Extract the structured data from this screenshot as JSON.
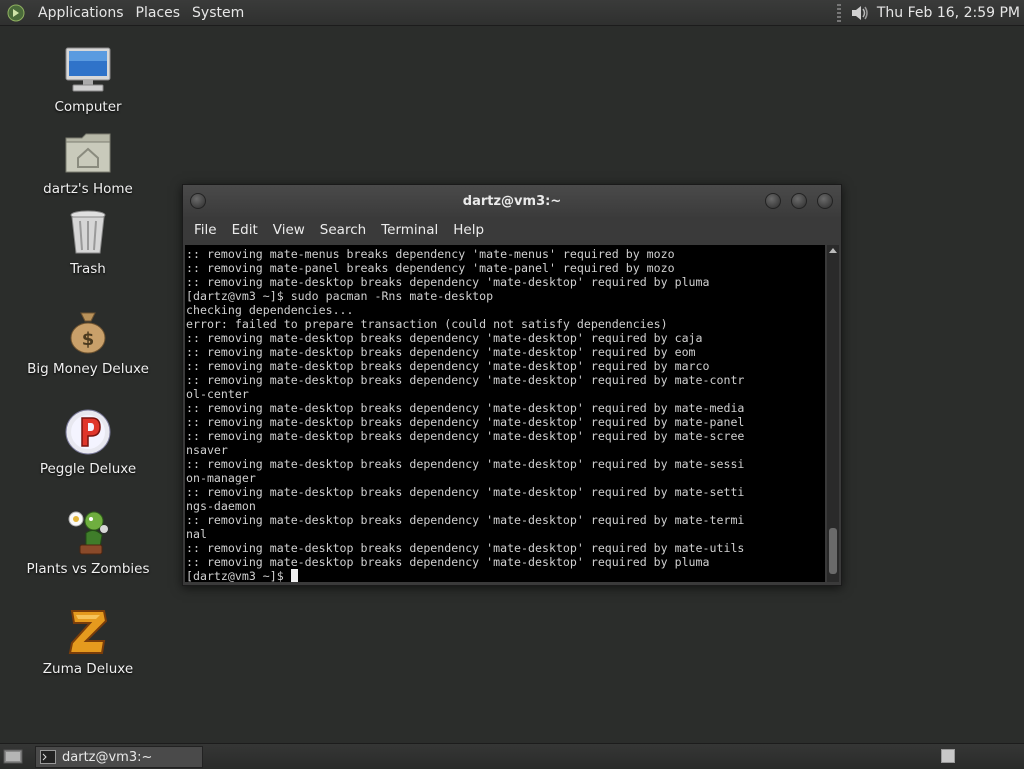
{
  "top_panel": {
    "menus": [
      "Applications",
      "Places",
      "System"
    ],
    "clock": "Thu Feb 16,  2:59 PM",
    "icons": {
      "logo": "mate-logo-icon",
      "volume": "volume-icon"
    }
  },
  "desktop": {
    "icons": [
      {
        "label": "Computer",
        "icon": "computer-icon"
      },
      {
        "label": "dartz's Home",
        "icon": "home-folder-icon"
      },
      {
        "label": "Trash",
        "icon": "trash-icon"
      },
      {
        "label": "Big Money Deluxe",
        "icon": "money-bag-icon"
      },
      {
        "label": "Peggle Deluxe",
        "icon": "peggle-icon"
      },
      {
        "label": "Plants vs Zombies",
        "icon": "plants-vs-zombies-icon"
      },
      {
        "label": "Zuma Deluxe",
        "icon": "zuma-icon"
      }
    ]
  },
  "terminal": {
    "title": "dartz@vm3:~",
    "menu": [
      "File",
      "Edit",
      "View",
      "Search",
      "Terminal",
      "Help"
    ],
    "lines": [
      ":: removing mate-menus breaks dependency 'mate-menus' required by mozo",
      ":: removing mate-panel breaks dependency 'mate-panel' required by mozo",
      ":: removing mate-desktop breaks dependency 'mate-desktop' required by pluma",
      "[dartz@vm3 ~]$ sudo pacman -Rns mate-desktop",
      "checking dependencies...",
      "error: failed to prepare transaction (could not satisfy dependencies)",
      ":: removing mate-desktop breaks dependency 'mate-desktop' required by caja",
      ":: removing mate-desktop breaks dependency 'mate-desktop' required by eom",
      ":: removing mate-desktop breaks dependency 'mate-desktop' required by marco",
      ":: removing mate-desktop breaks dependency 'mate-desktop' required by mate-contr",
      "ol-center",
      ":: removing mate-desktop breaks dependency 'mate-desktop' required by mate-media",
      ":: removing mate-desktop breaks dependency 'mate-desktop' required by mate-panel",
      ":: removing mate-desktop breaks dependency 'mate-desktop' required by mate-scree",
      "nsaver",
      ":: removing mate-desktop breaks dependency 'mate-desktop' required by mate-sessi",
      "on-manager",
      ":: removing mate-desktop breaks dependency 'mate-desktop' required by mate-setti",
      "ngs-daemon",
      ":: removing mate-desktop breaks dependency 'mate-desktop' required by mate-termi",
      "nal",
      ":: removing mate-desktop breaks dependency 'mate-desktop' required by mate-utils",
      ":: removing mate-desktop breaks dependency 'mate-desktop' required by pluma"
    ],
    "prompt": "[dartz@vm3 ~]$ "
  },
  "bottom_panel": {
    "task_title": "dartz@vm3:~",
    "icons": {
      "show_desktop": "show-desktop-icon",
      "task": "terminal-icon",
      "workspace": "workspace-switcher-icon"
    }
  }
}
